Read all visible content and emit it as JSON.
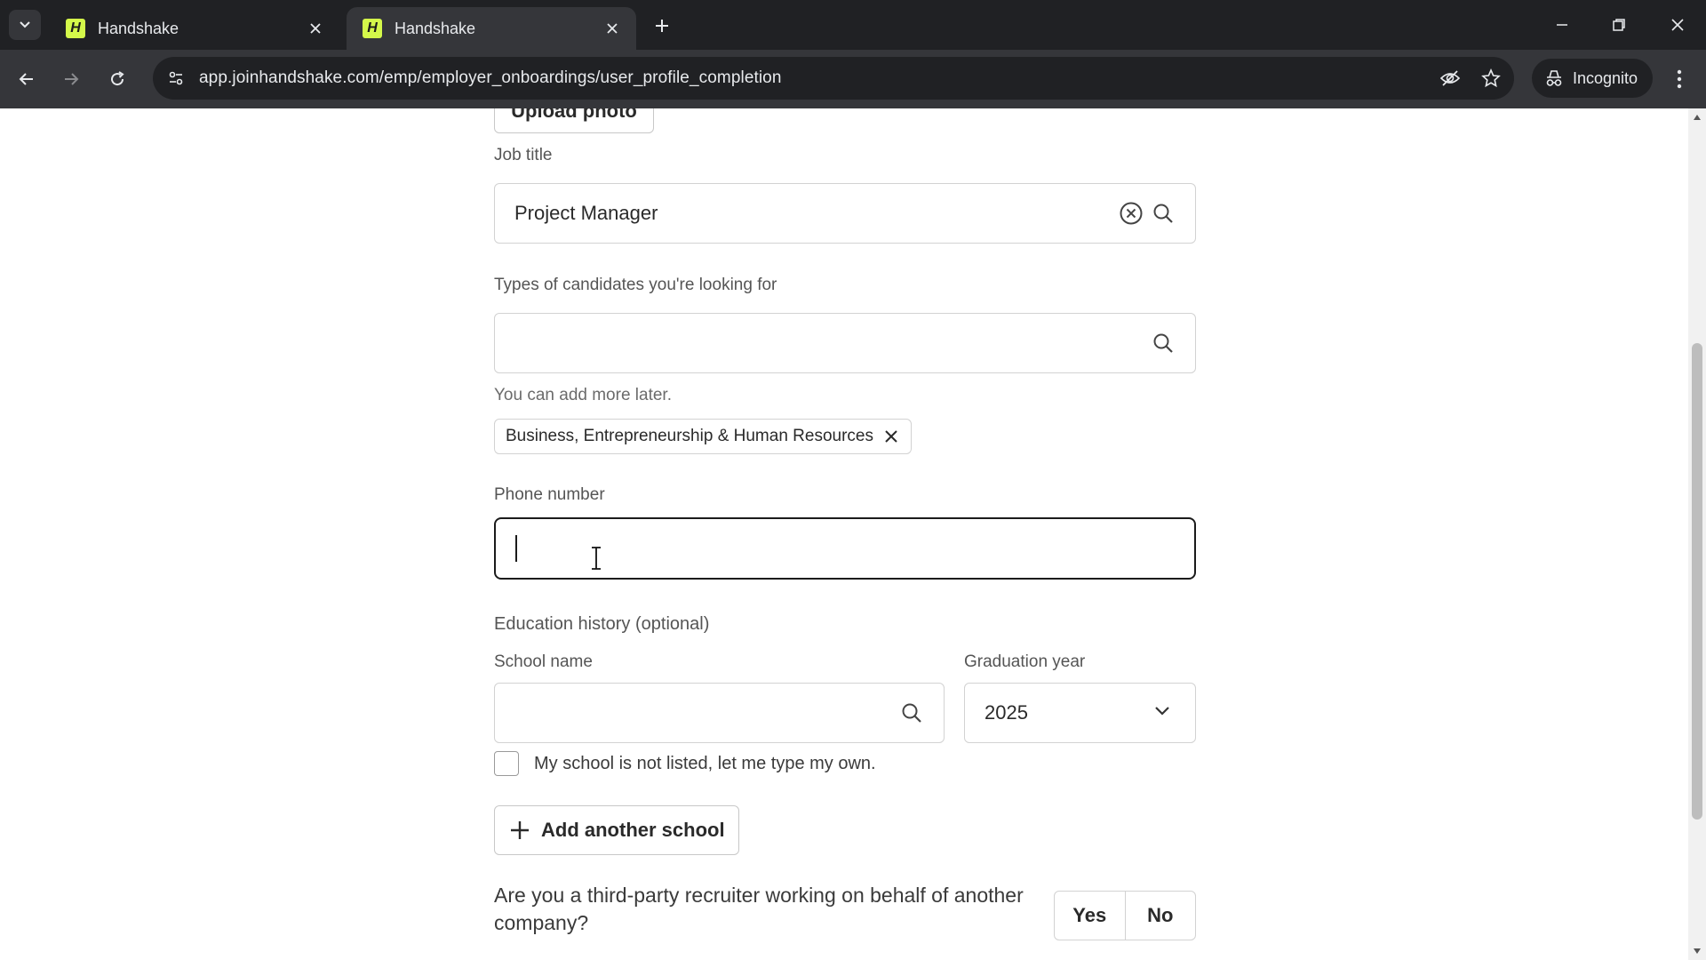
{
  "browser": {
    "tabs": [
      {
        "title": "Handshake",
        "favicon": "H",
        "active": false
      },
      {
        "title": "Handshake",
        "favicon": "H",
        "active": true
      }
    ],
    "url": "app.joinhandshake.com/emp/employer_onboardings/user_profile_completion",
    "incognito_label": "Incognito"
  },
  "form": {
    "upload_photo_label": "Upload photo",
    "job_title": {
      "label": "Job title",
      "value": "Project Manager"
    },
    "candidate_types": {
      "label": "Types of candidates you're looking for",
      "value": "",
      "helper": "You can add more later.",
      "chips": [
        "Business, Entrepreneurship & Human Resources"
      ]
    },
    "phone": {
      "label": "Phone number",
      "value": ""
    },
    "education": {
      "section_label": "Education history (optional)",
      "school_name_label": "School name",
      "school_name_value": "",
      "graduation_year_label": "Graduation year",
      "graduation_year_value": "2025",
      "not_listed_label": "My school is not listed, let me type my own.",
      "add_school_label": "Add another school"
    },
    "recruiter_question": {
      "text": "Are you a third-party recruiter working on behalf of another company?",
      "yes_label": "Yes",
      "no_label": "No"
    }
  }
}
